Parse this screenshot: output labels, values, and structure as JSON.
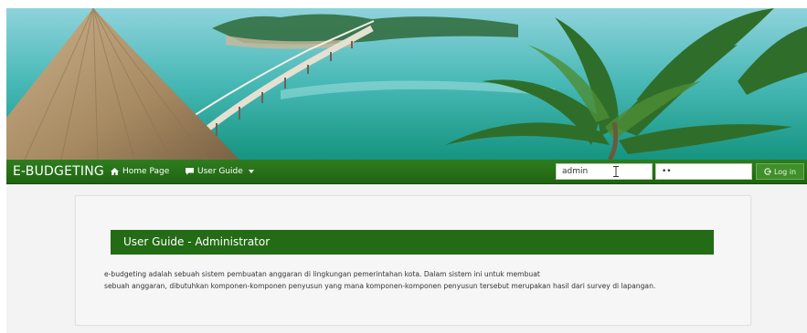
{
  "navbar": {
    "brand": "E-BUDGETING",
    "home_label": "Home Page",
    "guide_label": "User Guide",
    "username_value": "admin",
    "password_value": "••",
    "login_label": "Log in"
  },
  "guide": {
    "title": "User Guide - Administrator",
    "lines": [
      "e-budgeting adalah sebuah sistem pembuatan anggaran di lingkungan pemerintahan kota. Dalam sistem ini untuk membuat",
      "sebuah anggaran, dibutuhkan komponen-komponen penyusun yang mana komponen-komponen penyusun tersebut merupakan hasil dari survey di lapangan."
    ]
  },
  "colors": {
    "navbar": "#236b15",
    "header": "#236b15",
    "login_button": "#3f8f2a"
  },
  "icons": {
    "home": "home-icon",
    "guide": "comment-icon",
    "login": "login-icon"
  }
}
